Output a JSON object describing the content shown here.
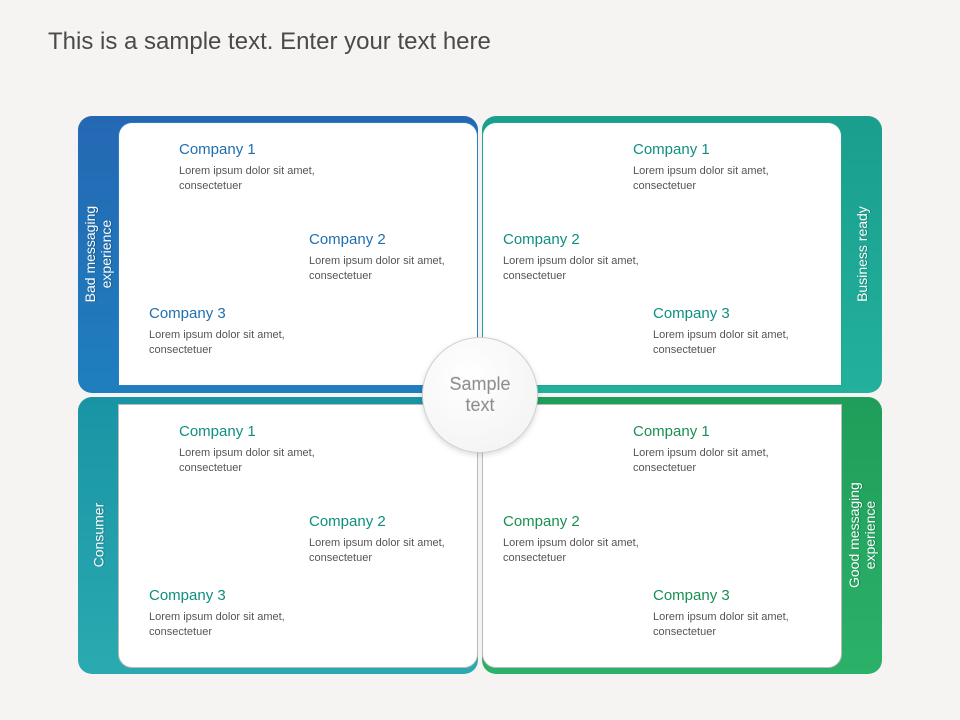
{
  "title": "This is a sample text. Enter your text here",
  "center": "Sample\ntext",
  "quads": {
    "tl": {
      "label": "Bad messaging\nexperience",
      "c1": {
        "title": "Company 1",
        "body": "Lorem ipsum dolor sit amet, consectetuer"
      },
      "c2": {
        "title": "Company 2",
        "body": "Lorem ipsum dolor sit amet, consectetuer"
      },
      "c3": {
        "title": "Company 3",
        "body": "Lorem ipsum dolor sit amet, consectetuer"
      }
    },
    "tr": {
      "label": "Business ready",
      "c1": {
        "title": "Company 1",
        "body": "Lorem ipsum dolor sit amet, consectetuer"
      },
      "c2": {
        "title": "Company 2",
        "body": "Lorem ipsum dolor sit amet, consectetuer"
      },
      "c3": {
        "title": "Company 3",
        "body": "Lorem ipsum dolor sit amet, consectetuer"
      }
    },
    "bl": {
      "label": "Consumer",
      "c1": {
        "title": "Company 1",
        "body": "Lorem ipsum dolor sit amet, consectetuer"
      },
      "c2": {
        "title": "Company 2",
        "body": "Lorem ipsum dolor sit amet, consectetuer"
      },
      "c3": {
        "title": "Company 3",
        "body": "Lorem ipsum dolor sit amet, consectetuer"
      }
    },
    "br": {
      "label": "Good messaging\nexperience",
      "c1": {
        "title": "Company 1",
        "body": "Lorem ipsum dolor sit amet, consectetuer"
      },
      "c2": {
        "title": "Company 2",
        "body": "Lorem ipsum dolor sit amet, consectetuer"
      },
      "c3": {
        "title": "Company 3",
        "body": "Lorem ipsum dolor sit amet, consectetuer"
      }
    }
  }
}
